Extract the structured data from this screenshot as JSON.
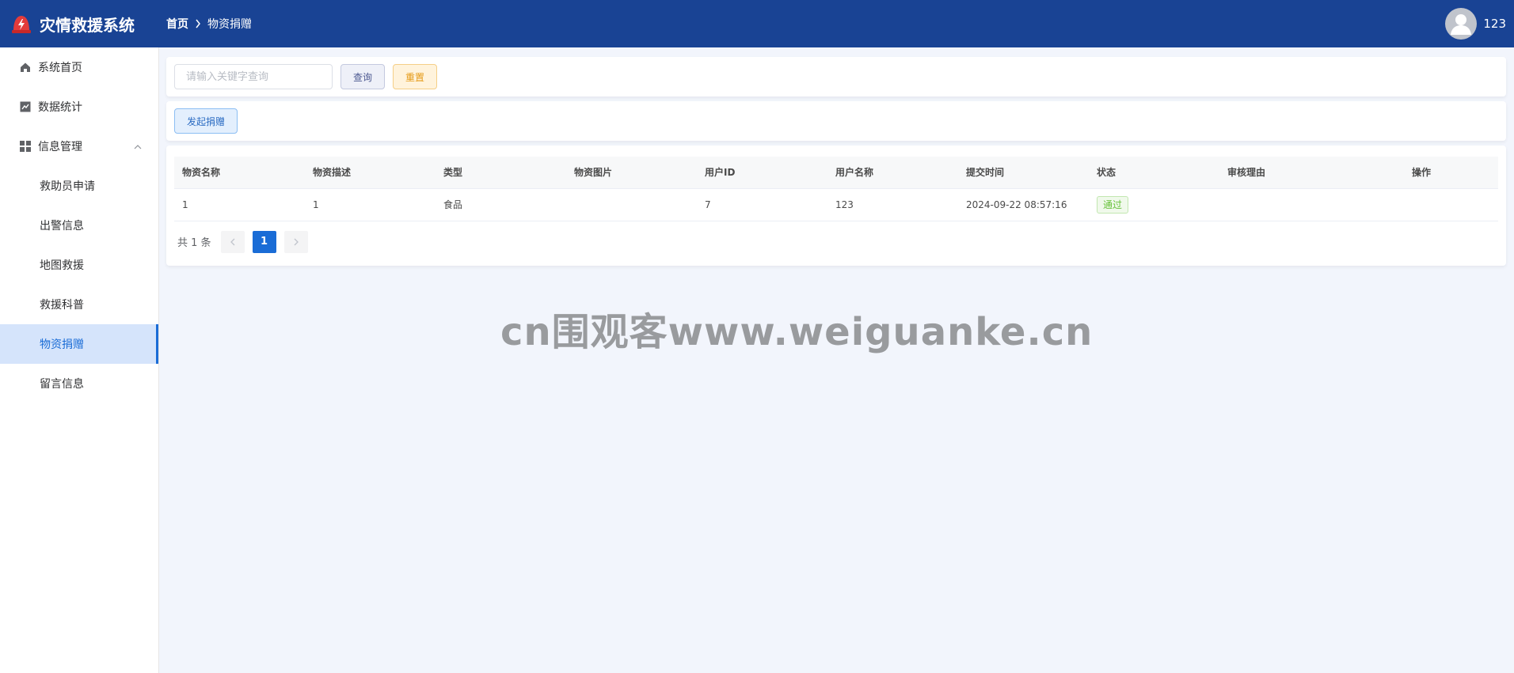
{
  "app": {
    "title": "灾情救援系统"
  },
  "breadcrumb": {
    "home": "首页",
    "current": "物资捐赠"
  },
  "user": {
    "name": "123"
  },
  "sidebar": {
    "items": [
      {
        "label": "系统首页",
        "icon": "home-icon"
      },
      {
        "label": "数据统计",
        "icon": "chart-icon"
      },
      {
        "label": "信息管理",
        "icon": "grid-icon"
      },
      {
        "label": "救助员申请"
      },
      {
        "label": "出警信息"
      },
      {
        "label": "地图救援"
      },
      {
        "label": "救援科普"
      },
      {
        "label": "物资捐赠",
        "active": true
      },
      {
        "label": "留言信息"
      }
    ]
  },
  "search": {
    "placeholder": "请输入关键字查询",
    "query_label": "查询",
    "reset_label": "重置"
  },
  "actions": {
    "donate_label": "发起捐赠"
  },
  "table": {
    "columns": [
      "物资名称",
      "物资描述",
      "类型",
      "物资图片",
      "用户ID",
      "用户名称",
      "提交时间",
      "状态",
      "审核理由",
      "操作"
    ],
    "rows": [
      {
        "name": "1",
        "desc": "1",
        "type": "食品",
        "image": "",
        "user_id": "7",
        "user_name": "123",
        "time": "2024-09-22 08:57:16",
        "status": "通过",
        "reason": "",
        "ops": ""
      }
    ]
  },
  "pagination": {
    "total": "共 1 条",
    "current": "1"
  },
  "watermark": "cn围观客www.weiguanke.cn",
  "colors": {
    "header": "#194394",
    "accent": "#1a6cd6",
    "success": "#67c23a",
    "warning": "#e59a16"
  }
}
